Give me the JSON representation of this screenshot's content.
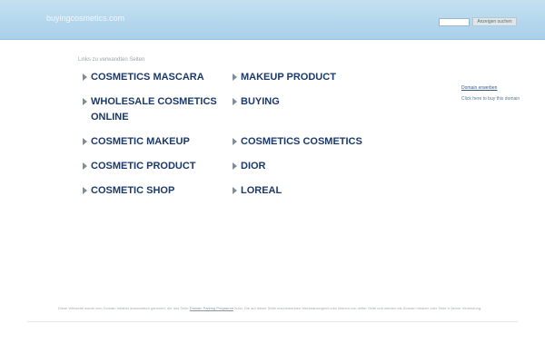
{
  "header": {
    "site_name": "buyingcosmetics.com",
    "search_placeholder": "",
    "search_button": "Anzeigen suchen"
  },
  "main": {
    "heading": "Links zu verwandten Seiten",
    "links": [
      {
        "label": "COSMETICS MASCARA"
      },
      {
        "label": "MAKEUP PRODUCT"
      },
      {
        "label": "WHOLESALE COSMETICS",
        "label2": "ONLINE"
      },
      {
        "label": "BUYING"
      },
      {
        "label": "COSMETIC MAKEUP"
      },
      {
        "label": "COSMETICS COSMETICS"
      },
      {
        "label": "COSMETIC PRODUCT"
      },
      {
        "label": "DIOR"
      },
      {
        "label": "COSMETIC SHOP"
      },
      {
        "label": "LOREAL"
      }
    ]
  },
  "sidebar": {
    "title": "Domain erwerben",
    "text": "Click here to buy this domain"
  },
  "footer": {
    "text_before": "Diese Webseite wurde vom Domain Inhaber automatisch generiert, der das Seite",
    "link": "Domain Parking Programm",
    "text_after": "nutzt. Die auf dieser Seite erscheinenden Werbeanzeigen/Links können von dritter Seite und werden mit Domain Inhaber oder Seite in keiner Verbindung."
  },
  "colors": {
    "header_gradient_top": "#c4e0f1",
    "header_gradient_bottom": "#a9d0ea",
    "link_color": "#1b3a6b"
  }
}
